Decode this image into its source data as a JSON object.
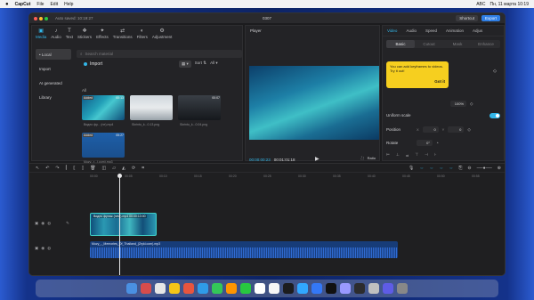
{
  "menubar": {
    "apple": "",
    "app": "CapCut",
    "items": [
      "File",
      "Edit",
      "Help"
    ],
    "status_right": "Пн, 11 марта  10:19",
    "kbd": "ABC"
  },
  "window": {
    "title": "0307",
    "autosave": "Auto saved: 10:19:27",
    "shortcut_label": "Shortcut",
    "export_label": "Export"
  },
  "media": {
    "tabs": [
      {
        "icon": "▣",
        "label": "Media"
      },
      {
        "icon": "♪",
        "label": "Audio"
      },
      {
        "icon": "T",
        "label": "Text"
      },
      {
        "icon": "❖",
        "label": "Stickers"
      },
      {
        "icon": "✦",
        "label": "Effects"
      },
      {
        "icon": "⇄",
        "label": "Transitions"
      },
      {
        "icon": "◐",
        "label": "Filters"
      },
      {
        "icon": "⚙",
        "label": "Adjustment"
      }
    ],
    "sidebar": [
      "• Local",
      "Import",
      "AI generated",
      "Library"
    ],
    "search_placeholder": "Search material",
    "import_label": "Import",
    "sort_label": "Sort",
    "all_label": "All",
    "view_label": "All",
    "items": [
      {
        "added": "Added",
        "duration": "00:13",
        "caption": "Видео фу... (ne).mp4"
      },
      {
        "added": "",
        "duration": "",
        "caption": "Skrinto_k...0.13.png"
      },
      {
        "added": "",
        "duration": "00:07",
        "caption": "Skrinto_k...0.04.png"
      },
      {
        "added": "Added",
        "duration": "05:27",
        "caption": "Muzy...r...(.com).mp3"
      }
    ]
  },
  "player": {
    "title": "Player",
    "current": "00:00:00:23",
    "total": "00:01:01:18",
    "ratio": "Ratio",
    "fit": "⛶"
  },
  "inspector": {
    "tabs": [
      "Video",
      "Audio",
      "Speed",
      "Animation",
      "Adjus"
    ],
    "subtabs": [
      "Basic",
      "Cutout",
      "Mask",
      "Enhance"
    ],
    "tip_text": "You can add keyframes to videos. Try it out!",
    "tip_button": "Got it",
    "scale_value": "100%",
    "uniform_scale": "Uniform scale",
    "position_label": "Position",
    "pos_x": "0",
    "pos_y": "0",
    "rotate_label": "Rotate",
    "rotate_value": "0°"
  },
  "timeline": {
    "ruler": [
      "00:00",
      "00:05",
      "00:10",
      "00:15",
      "00:20",
      "00:25",
      "00:30",
      "00:35",
      "00:40",
      "00:45",
      "00:50",
      "00:55",
      "01:00"
    ],
    "video_clip_label": "Видео футаж (new).mp4  00:00:13:00",
    "audio_clip_label": "Muzy_-_Memories_Of_Thailand_(Zryki.com).mp3"
  }
}
